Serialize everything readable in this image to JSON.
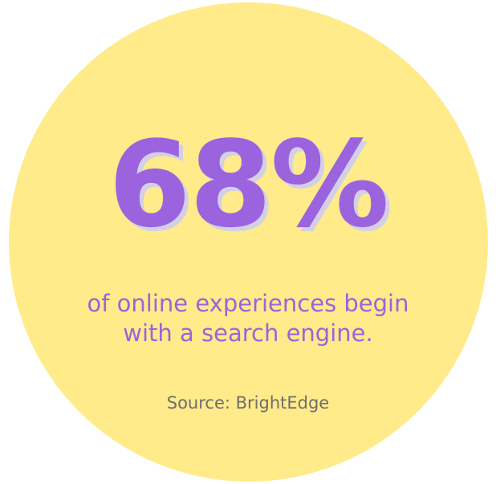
{
  "stat": {
    "value": "68%"
  },
  "caption": {
    "line1": "of online experiences begin",
    "line2": "with a search engine."
  },
  "source": {
    "label": "Source: BrightEdge"
  },
  "colors": {
    "circle": "#FFEB8A",
    "accent": "#9B63DD",
    "shadow": "#D2D0E6",
    "source_text": "#6E6E6E",
    "background": "#FFFFFF"
  }
}
